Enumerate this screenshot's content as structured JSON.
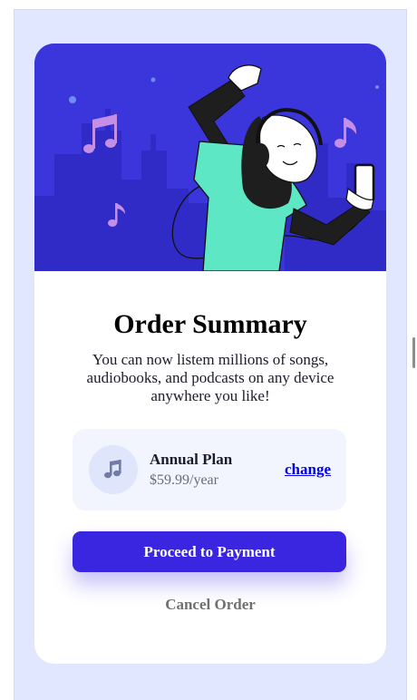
{
  "page": {
    "corner_glyph": "+"
  },
  "summary": {
    "title": "Order Summary",
    "description": "You can now listem millions of songs, audiobooks, and podcasts on any device anywhere you like!"
  },
  "plan": {
    "icon": "music-note-icon",
    "name": "Annual Plan",
    "price": "$59.99/year",
    "change_label": "change"
  },
  "actions": {
    "pay_label": "Proceed to Payment",
    "cancel_label": "Cancel Order"
  },
  "colors": {
    "page_background": "#e0e7fe",
    "hero_background": "#3b35dc",
    "primary_button": "#3a26e0",
    "plan_background": "#f2f5fe",
    "link": "#0000ee",
    "music_notes": "#c58fe8",
    "shirt": "#5ee7c4"
  }
}
